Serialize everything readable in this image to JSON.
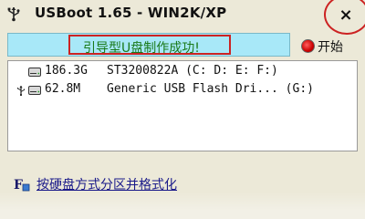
{
  "window": {
    "title": "USBoot 1.65 - WIN2K/XP",
    "app_icon": "usb-plug-icon",
    "close_label": "×"
  },
  "status": {
    "message": "引导型U盘制作成功!"
  },
  "start": {
    "label": "开始",
    "icon": "red-radio-icon"
  },
  "drives": [
    {
      "icon": "hard-disk-icon",
      "usb": false,
      "size": "186.3G",
      "name": "ST3200822A (C: D: E: F:)"
    },
    {
      "icon": "hard-disk-icon",
      "usb": true,
      "size": "62.8M",
      "name": "Generic USB Flash Dri... (G:)"
    }
  ],
  "mode": {
    "label": "按硬盘方式分区并格式化",
    "icon": "format-mode-icon"
  },
  "colors": {
    "status_bg": "#a8e8f8",
    "status_text": "#1a7a1a",
    "highlight_ring": "#cc2222",
    "window_bg": "#ece9d8"
  }
}
